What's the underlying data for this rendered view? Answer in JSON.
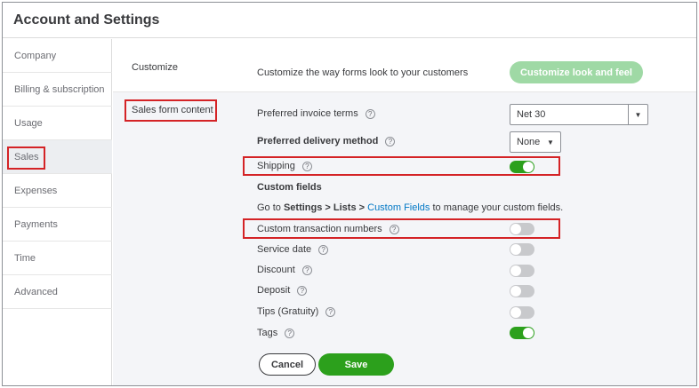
{
  "header": {
    "title": "Account and Settings"
  },
  "sidebar": {
    "items": [
      {
        "label": "Company"
      },
      {
        "label": "Billing & subscription"
      },
      {
        "label": "Usage"
      },
      {
        "label": "Sales"
      },
      {
        "label": "Expenses"
      },
      {
        "label": "Payments"
      },
      {
        "label": "Time"
      },
      {
        "label": "Advanced"
      }
    ],
    "active": "Sales"
  },
  "customize": {
    "section_label": "Customize",
    "description": "Customize the way forms look to your customers",
    "button_label": "Customize look and feel"
  },
  "sales_form": {
    "section_label": "Sales form content",
    "invoice_terms_label": "Preferred invoice terms",
    "invoice_terms_value": "Net 30",
    "delivery_label": "Preferred delivery method",
    "delivery_value": "None",
    "shipping_label": "Shipping",
    "shipping_on": true,
    "custom_fields_heading": "Custom fields",
    "custom_fields_text_before": "Go to ",
    "custom_fields_path": "Settings > Lists >",
    "custom_fields_link": "Custom Fields",
    "custom_fields_text_after": " to manage your custom fields.",
    "toggles": [
      {
        "label": "Custom transaction numbers",
        "on": false
      },
      {
        "label": "Service date",
        "on": false
      },
      {
        "label": "Discount",
        "on": false
      },
      {
        "label": "Deposit",
        "on": false
      },
      {
        "label": "Tips (Gratuity)",
        "on": false
      },
      {
        "label": "Tags",
        "on": true
      }
    ],
    "help_glyph": "?"
  },
  "actions": {
    "cancel_label": "Cancel",
    "save_label": "Save"
  },
  "colors": {
    "accent": "#2ca01c",
    "accent_disabled": "#9fd9a5",
    "highlight": "#d42326",
    "link": "#0077c5"
  },
  "icons": {
    "help": "help-circle-icon",
    "dropdown": "chevron-down-icon"
  }
}
